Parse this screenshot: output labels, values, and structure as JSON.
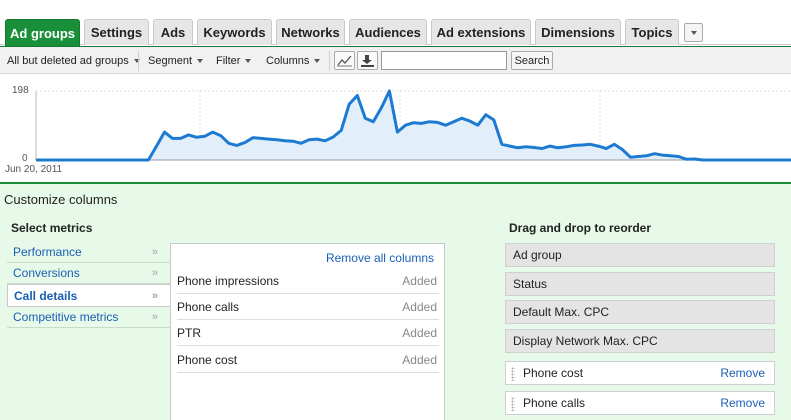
{
  "tabs": [
    {
      "label": "Ad groups",
      "active": true
    },
    {
      "label": "Settings"
    },
    {
      "label": "Ads"
    },
    {
      "label": "Keywords"
    },
    {
      "label": "Networks"
    },
    {
      "label": "Audiences"
    },
    {
      "label": "Ad extensions"
    },
    {
      "label": "Dimensions"
    },
    {
      "label": "Topics"
    }
  ],
  "toolbar": {
    "status_filter": "All but deleted ad groups",
    "segment": "Segment",
    "filter": "Filter",
    "columns": "Columns",
    "search_value": "",
    "search_button": "Search"
  },
  "chart_data": {
    "type": "area",
    "y_max_label": "198",
    "y_min_label": "0",
    "x_start_label": "Jun 20, 2011",
    "ylim": [
      0,
      198
    ],
    "color": "#1c7bd0",
    "fill": "#e3eefb",
    "values": [
      0,
      0,
      0,
      0,
      0,
      0,
      0,
      0,
      0,
      0,
      0,
      0,
      0,
      0,
      0,
      40,
      80,
      62,
      62,
      72,
      65,
      68,
      80,
      70,
      48,
      42,
      50,
      64,
      62,
      60,
      58,
      55,
      54,
      48,
      58,
      60,
      55,
      66,
      85,
      160,
      185,
      120,
      110,
      150,
      198,
      80,
      100,
      107,
      105,
      110,
      108,
      100,
      110,
      120,
      112,
      100,
      130,
      115,
      45,
      40,
      35,
      38,
      36,
      33,
      40,
      35,
      38,
      42,
      43,
      45,
      40,
      33,
      45,
      30,
      8,
      10,
      12,
      18,
      14,
      12,
      10,
      2,
      3,
      0,
      0,
      0,
      0,
      0,
      0,
      0,
      0,
      0,
      0,
      0,
      0
    ]
  },
  "panel": {
    "title": "Customize columns",
    "select_metrics": "Select metrics",
    "reorder_title": "Drag and drop to reorder",
    "remove_all": "Remove all columns",
    "categories": [
      {
        "label": "Performance",
        "arrow": "»"
      },
      {
        "label": "Conversions",
        "arrow": "»"
      },
      {
        "label": "Call details",
        "arrow": "»",
        "selected": true
      },
      {
        "label": "Competitive metrics",
        "arrow": "»"
      }
    ],
    "metrics": [
      {
        "label": "Phone impressions",
        "status": "Added"
      },
      {
        "label": "Phone calls",
        "status": "Added"
      },
      {
        "label": "PTR",
        "status": "Added"
      },
      {
        "label": "Phone cost",
        "status": "Added"
      }
    ],
    "fixed_columns": [
      "Ad group",
      "Status",
      "Default Max. CPC",
      "Display Network Max. CPC"
    ],
    "movable_columns": [
      {
        "label": "Phone cost",
        "action": "Remove"
      },
      {
        "label": "Phone calls",
        "action": "Remove"
      }
    ]
  }
}
